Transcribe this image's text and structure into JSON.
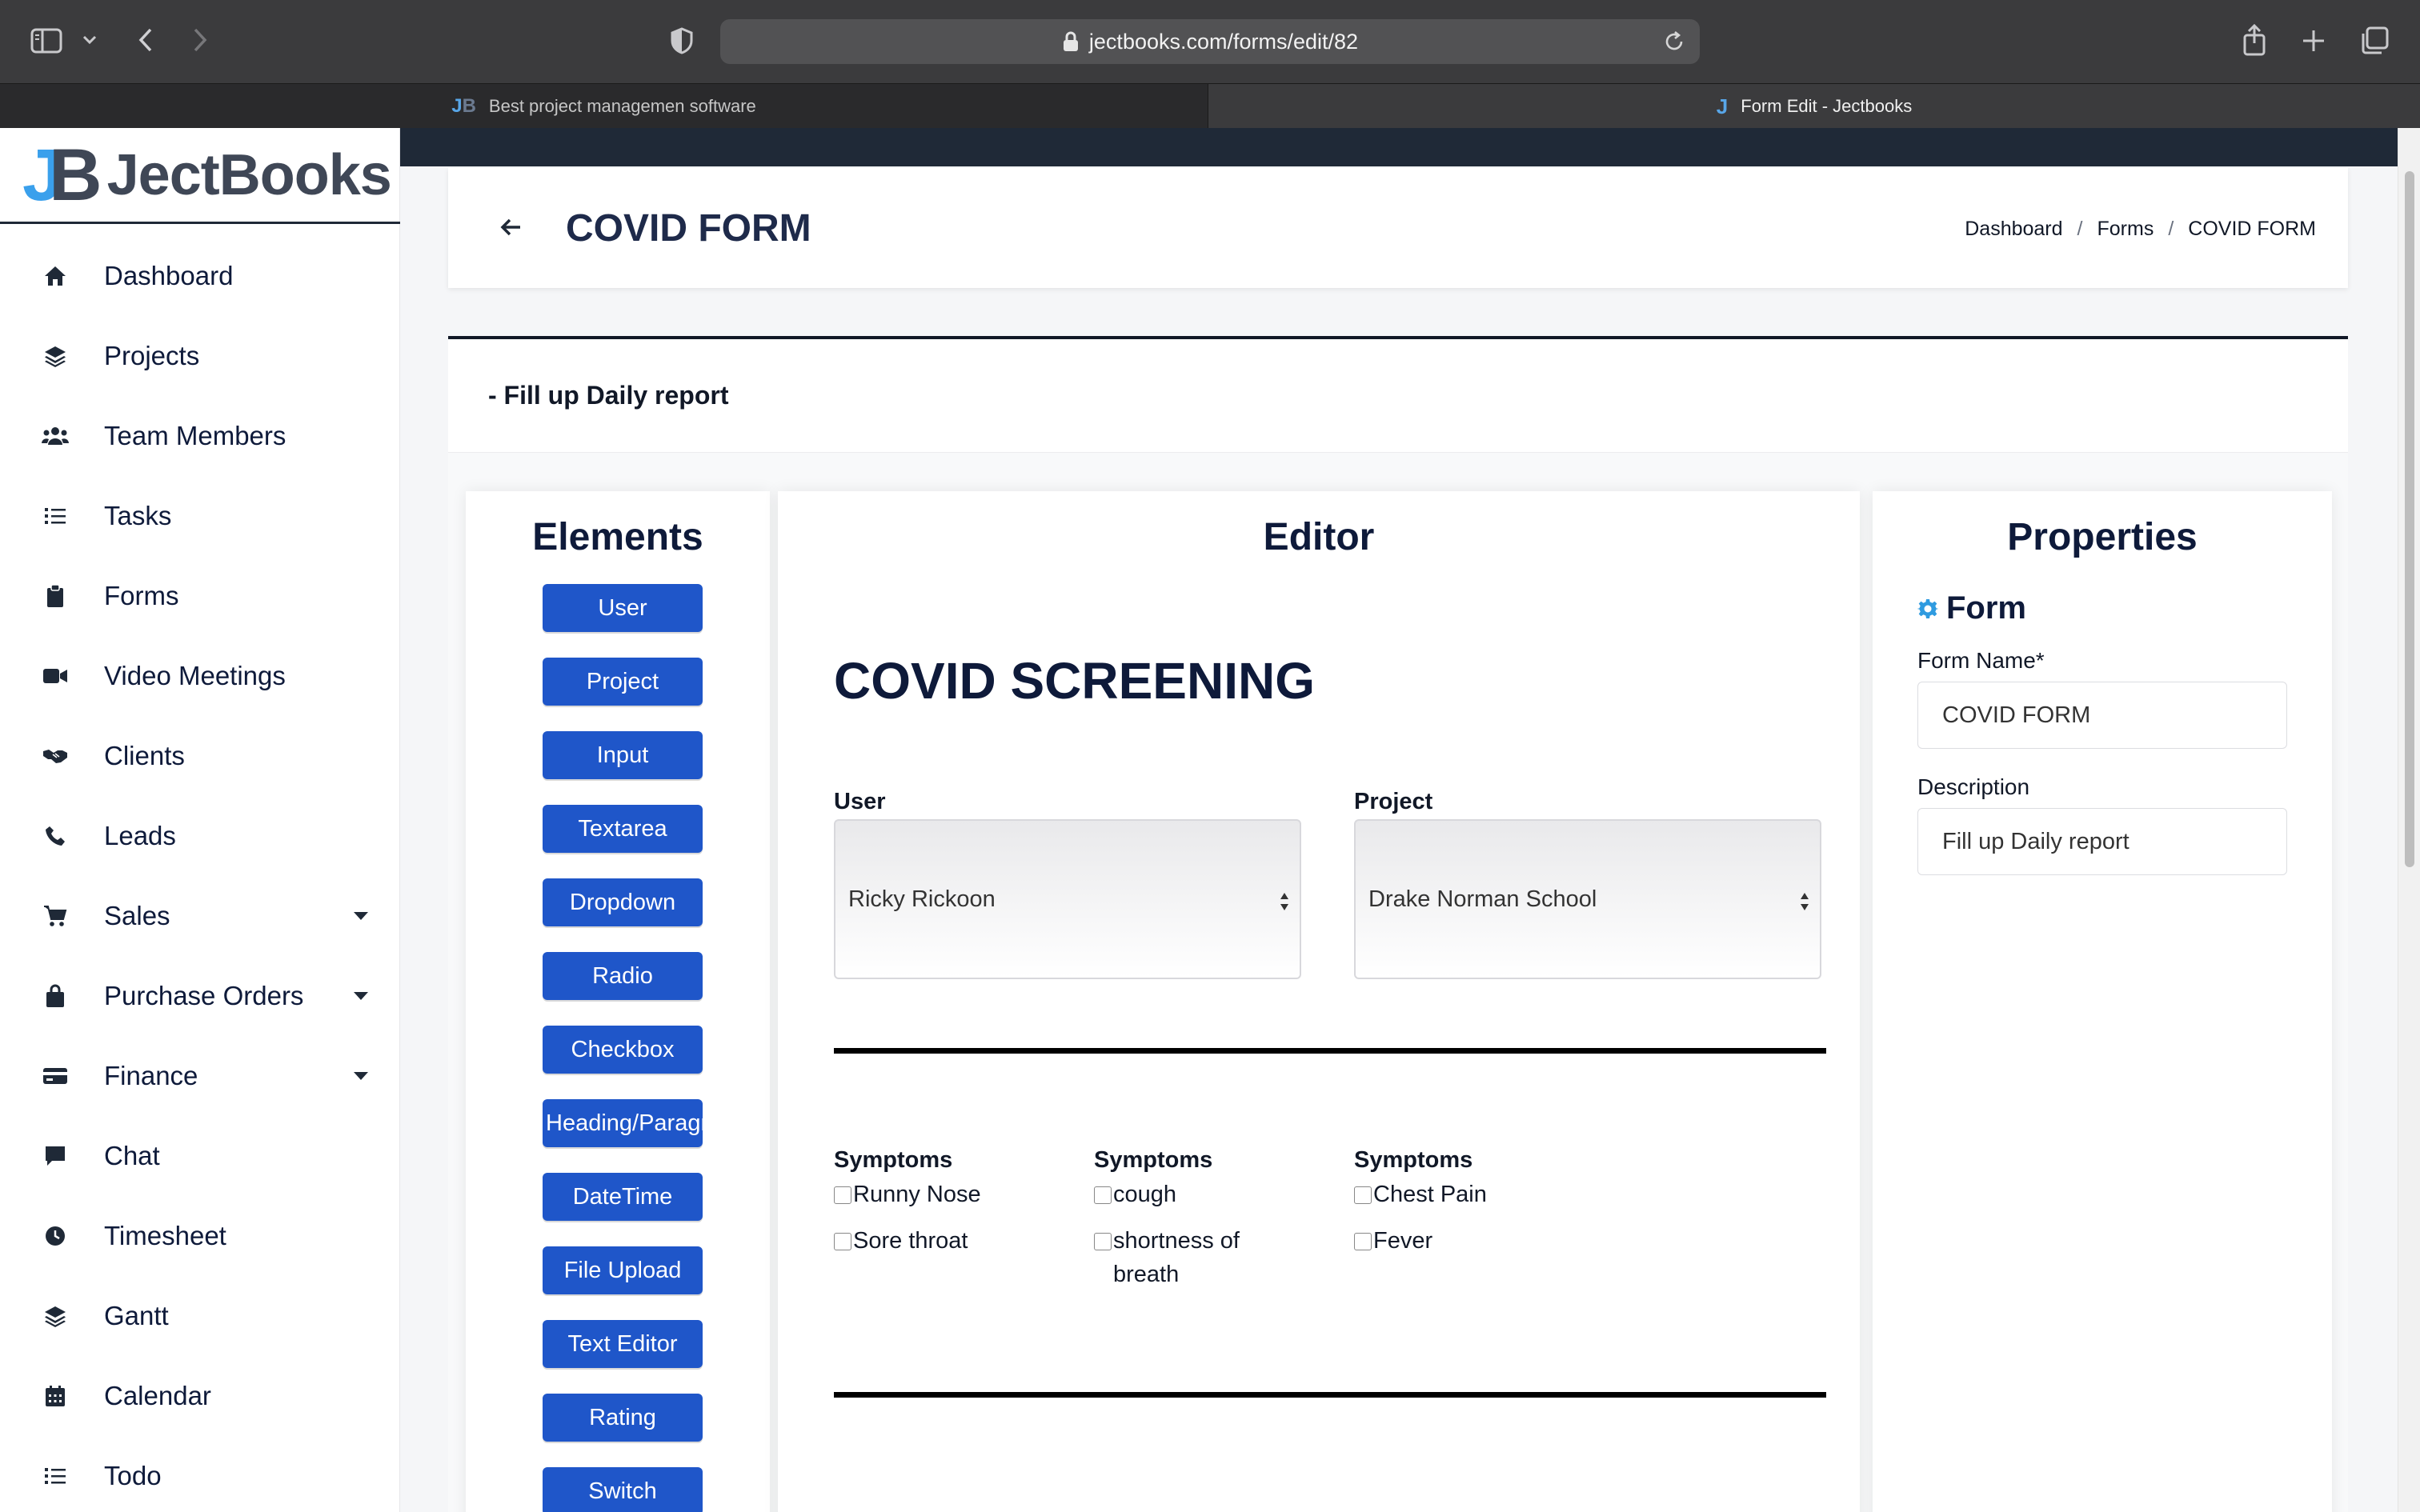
{
  "browser": {
    "url": "jectbooks.com/forms/edit/82",
    "tabs": [
      {
        "label": "Best project managemen software"
      },
      {
        "label": "Form Edit - Jectbooks"
      }
    ]
  },
  "app": {
    "logo_word": "JectBooks",
    "logo_mark_j": "J",
    "logo_mark_b": "B"
  },
  "sidebar": {
    "items": [
      {
        "label": "Dashboard",
        "icon": "home-icon"
      },
      {
        "label": "Projects",
        "icon": "layers-icon"
      },
      {
        "label": "Team Members",
        "icon": "users-icon"
      },
      {
        "label": "Tasks",
        "icon": "list-icon"
      },
      {
        "label": "Forms",
        "icon": "clipboard-icon"
      },
      {
        "label": "Video Meetings",
        "icon": "video-icon"
      },
      {
        "label": "Clients",
        "icon": "handshake-icon"
      },
      {
        "label": "Leads",
        "icon": "phone-icon"
      },
      {
        "label": "Sales",
        "icon": "cart-icon"
      },
      {
        "label": "Purchase Orders",
        "icon": "bag-icon"
      },
      {
        "label": "Finance",
        "icon": "credit-card-icon"
      },
      {
        "label": "Chat",
        "icon": "chat-icon"
      },
      {
        "label": "Timesheet",
        "icon": "clock-icon"
      },
      {
        "label": "Gantt",
        "icon": "layers-icon"
      },
      {
        "label": "Calendar",
        "icon": "calendar-icon"
      },
      {
        "label": "Todo",
        "icon": "list-icon"
      }
    ]
  },
  "header": {
    "title": "COVID FORM",
    "breadcrumb": [
      "Dashboard",
      "Forms",
      "COVID FORM"
    ],
    "separator": "/"
  },
  "card": {
    "subtitle": "- Fill up Daily report"
  },
  "elements": {
    "title": "Elements",
    "buttons": [
      "User",
      "Project",
      "Input",
      "Textarea",
      "Dropdown",
      "Radio",
      "Checkbox",
      "Heading/Paragraph",
      "DateTime",
      "File Upload",
      "Text Editor",
      "Rating",
      "Switch"
    ]
  },
  "editor": {
    "title": "Editor",
    "heading": "COVID SCREENING",
    "user_label": "User",
    "user_value": "Ricky Rickoon",
    "project_label": "Project",
    "project_value": "Drake Norman School",
    "symptom_groups": [
      {
        "title": "Symptoms",
        "options": [
          "Runny Nose",
          "Sore throat"
        ]
      },
      {
        "title": "Symptoms",
        "options": [
          "cough",
          "shortness of breath"
        ]
      },
      {
        "title": "Symptoms",
        "options": [
          "Chest Pain",
          "Fever"
        ]
      }
    ]
  },
  "properties": {
    "title": "Properties",
    "section": "Form",
    "form_name_label": "Form Name*",
    "form_name_value": "COVID FORM",
    "description_label": "Description",
    "description_value": "Fill up Daily report"
  }
}
